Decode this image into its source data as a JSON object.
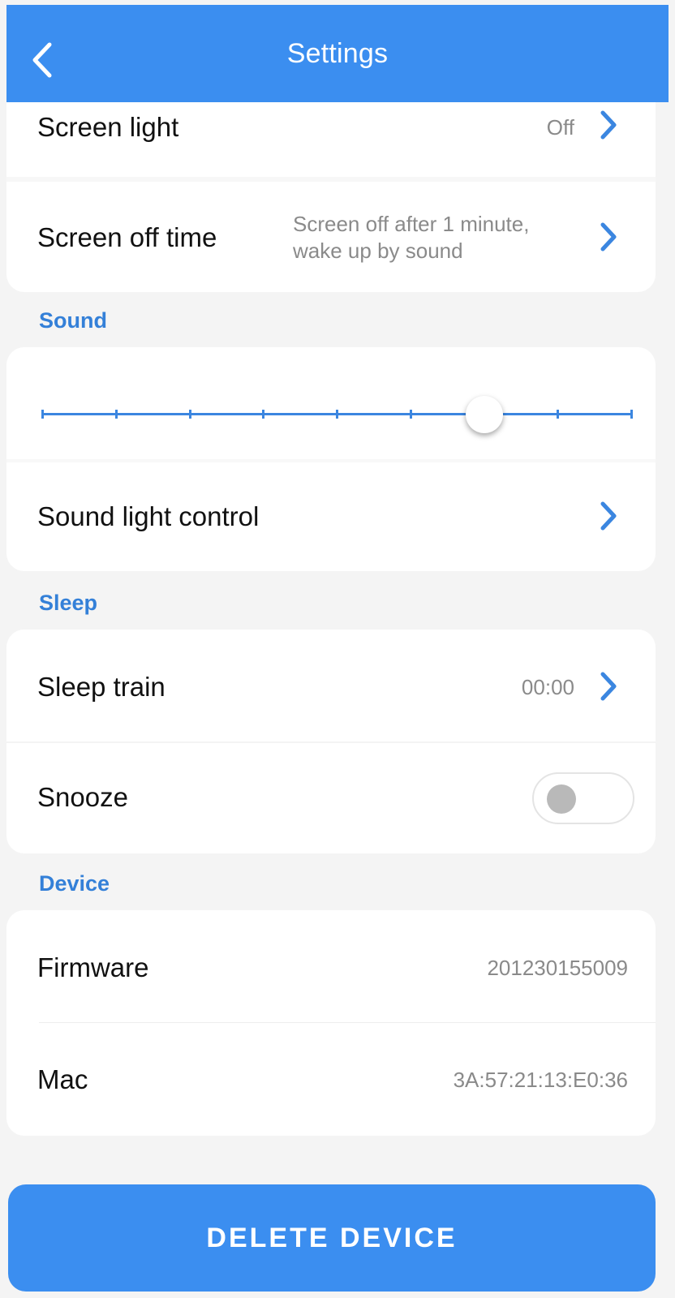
{
  "header": {
    "title": "Settings",
    "back_icon": "chevron-left-icon"
  },
  "display": {
    "screen_light": {
      "label": "Screen light",
      "value": "Off"
    },
    "screen_off_time": {
      "label": "Screen off time",
      "value_line1": "Screen off after 1 minute,",
      "value_line2": "wake up by sound"
    }
  },
  "sound": {
    "section_title": "Sound",
    "volume_level": 0.75,
    "volume_steps": 8,
    "sound_light_control": {
      "label": "Sound light control"
    }
  },
  "sleep": {
    "section_title": "Sleep",
    "sleep_train": {
      "label": "Sleep train",
      "value": "00:00"
    },
    "snooze": {
      "label": "Snooze",
      "enabled": false
    }
  },
  "device": {
    "section_title": "Device",
    "firmware": {
      "label": "Firmware",
      "value": "201230155009"
    },
    "mac": {
      "label": "Mac",
      "value": "3A:57:21:13:E0:36"
    }
  },
  "delete_button": {
    "label": "DELETE DEVICE"
  },
  "colors": {
    "accent": "#3b8ef0",
    "section": "#3480d8",
    "background": "#f4f4f4"
  }
}
